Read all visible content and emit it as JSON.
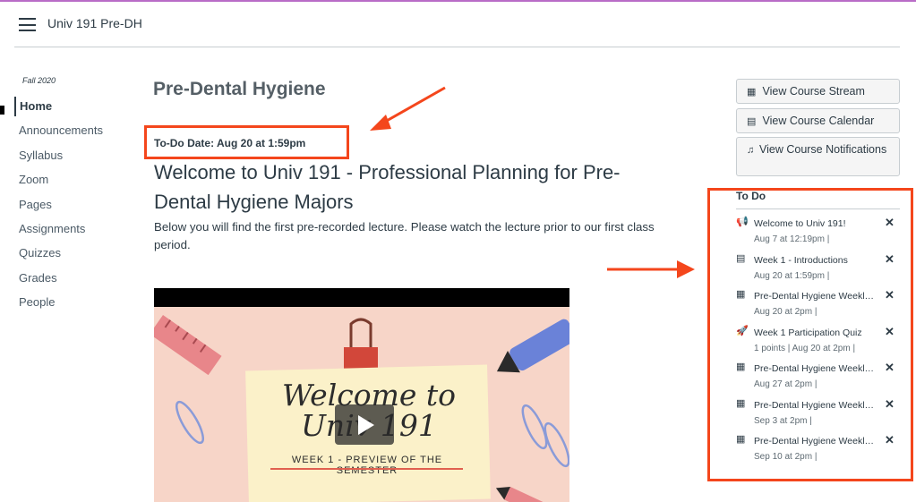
{
  "header": {
    "course_title": "Univ 191 Pre-DH"
  },
  "sidebar": {
    "term": "Fall 2020",
    "items": [
      {
        "label": "Home"
      },
      {
        "label": "Announcements"
      },
      {
        "label": "Syllabus"
      },
      {
        "label": "Zoom"
      },
      {
        "label": "Pages"
      },
      {
        "label": "Assignments"
      },
      {
        "label": "Quizzes"
      },
      {
        "label": "Grades"
      },
      {
        "label": "People"
      }
    ]
  },
  "main": {
    "page_title": "Pre-Dental Hygiene",
    "todo_date": "To-Do Date: Aug 20 at 1:59pm",
    "heading": "Welcome to Univ 191 - Professional Planning for Pre-Dental Hygiene Majors",
    "intro": "Below you will find the first pre-recorded lecture. Please watch the lecture prior to our first class period.",
    "video": {
      "welcome_text": "Welcome to Univ 191",
      "subtitle": "WEEK 1 - PREVIEW OF THE SEMESTER"
    }
  },
  "right_sidebar": {
    "buttons": [
      {
        "label": "View Course Stream",
        "icon": "chart-icon"
      },
      {
        "label": "View Course Calendar",
        "icon": "calendar-icon"
      },
      {
        "label": "View Course Notifications",
        "icon": "bell-icon"
      }
    ],
    "todo_heading": "To Do",
    "todo_items": [
      {
        "icon": "announcement-icon",
        "title": "Welcome to Univ 191!",
        "meta": "Aug 7 at 12:19pm  |"
      },
      {
        "icon": "page-icon",
        "title": "Week 1 - Introductions",
        "meta": "Aug 20 at 1:59pm  |"
      },
      {
        "icon": "assignment-icon",
        "title": "Pre-Dental Hygiene Weekly Reflection",
        "meta": "Aug 20 at 2pm  |"
      },
      {
        "icon": "quiz-icon",
        "title": "Week 1 Participation Quiz",
        "meta": "1 points  |  Aug 20 at 2pm  |"
      },
      {
        "icon": "assignment-icon",
        "title": "Pre-Dental Hygiene Weekly Reflection",
        "meta": "Aug 27 at 2pm  |"
      },
      {
        "icon": "assignment-icon",
        "title": "Pre-Dental Hygiene Weekly Reflection",
        "meta": "Sep 3 at 2pm  |"
      },
      {
        "icon": "assignment-icon",
        "title": "Pre-Dental Hygiene Weekly Reflection",
        "meta": "Sep 10 at 2pm  |"
      }
    ]
  },
  "colors": {
    "highlight": "#f4461c",
    "accent_topline": "#b96cc7",
    "text": "#2d3b45"
  }
}
